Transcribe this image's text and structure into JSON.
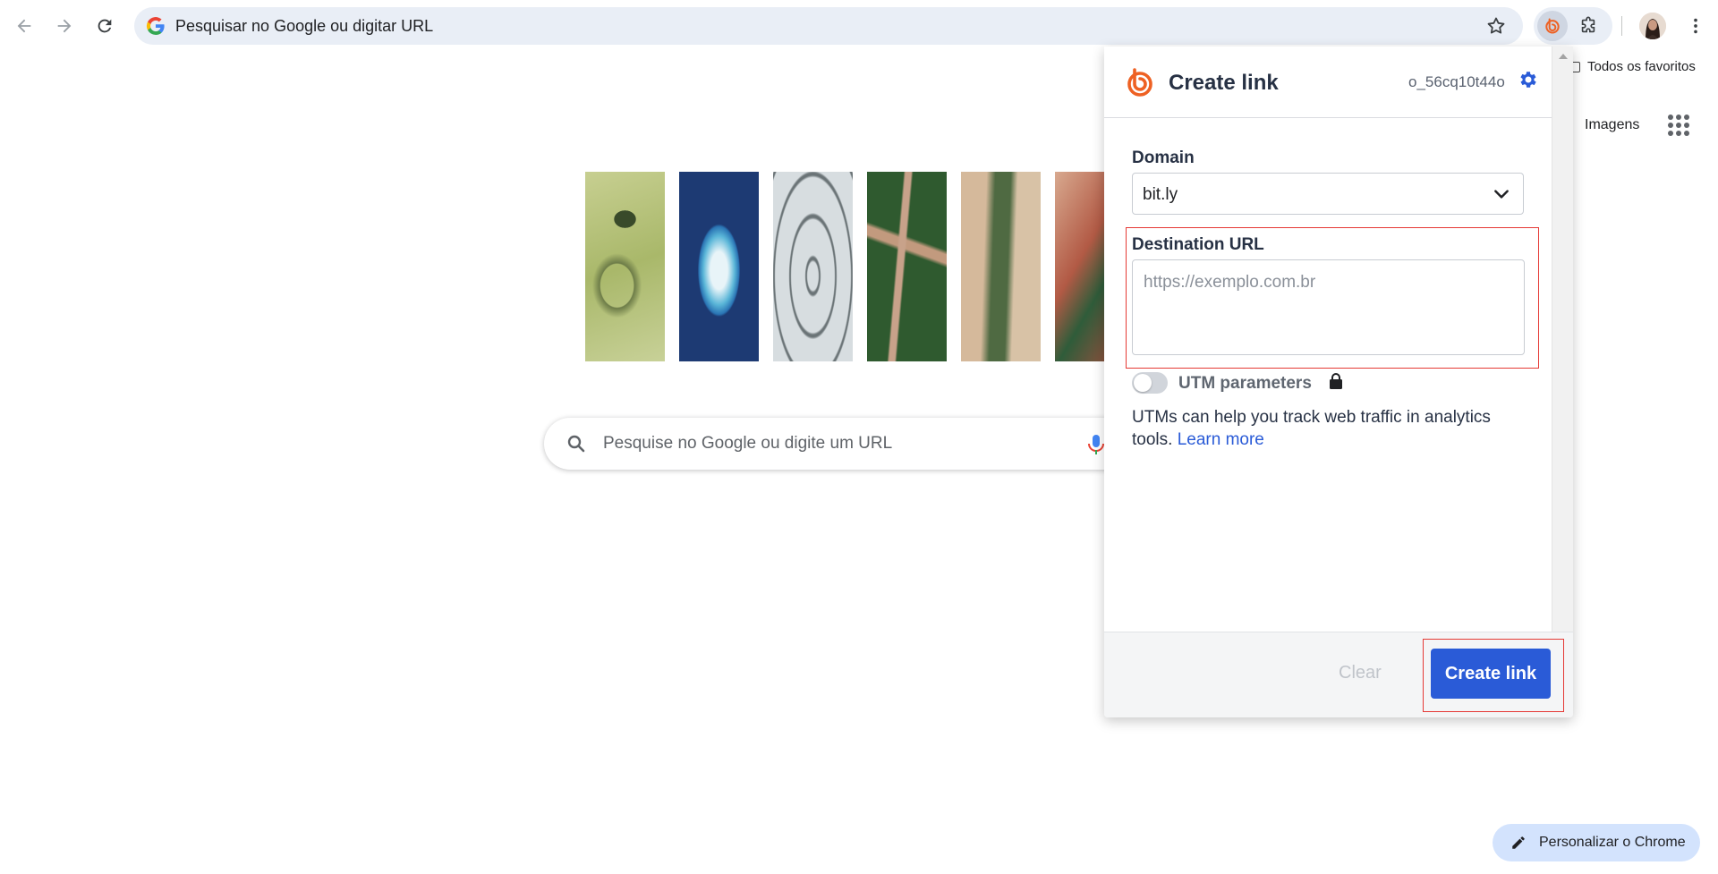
{
  "browser": {
    "omnibox_text": "Pesquisar no Google ou digitar URL",
    "bookmarks_label": "Todos os favoritos",
    "accent": "#1a73e8"
  },
  "ntp": {
    "images_link": "Imagens",
    "search_placeholder": "Pesquise no Google ou digite um URL",
    "customize_label": "Personalizar o Chrome"
  },
  "popup": {
    "title": "Create link",
    "user_id": "o_56cq10t44o",
    "domain_label": "Domain",
    "domain_value": "bit.ly",
    "destination_label": "Destination URL",
    "destination_placeholder": "https://exemplo.com.br",
    "utm_label": "UTM parameters",
    "utm_enabled": false,
    "utm_help": "UTMs can help you track web traffic in analytics tools.",
    "learn_more": "Learn more",
    "clear_label": "Clear",
    "create_label": "Create link",
    "colors": {
      "brand_orange": "#ee6123",
      "primary_blue": "#2a5bd7",
      "highlight_red": "#e53935"
    }
  }
}
